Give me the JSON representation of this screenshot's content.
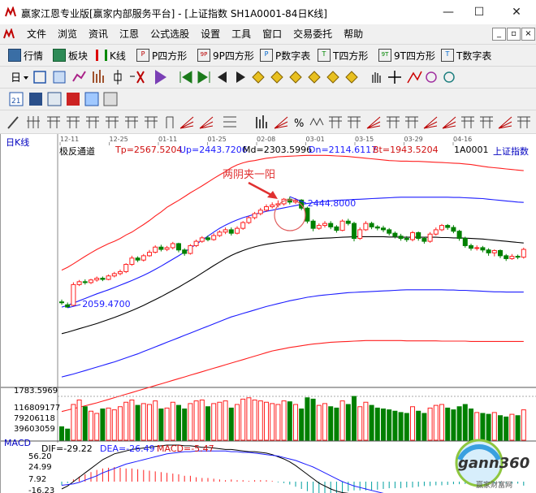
{
  "window": {
    "title": "赢家江恩专业版[赢家内部服务平台] - [上证指数  SH1A0001-84日K线]",
    "controls": [
      "—",
      "☐",
      "✕"
    ]
  },
  "menu": {
    "items": [
      "文件",
      "浏览",
      "资讯",
      "江恩",
      "公式选股",
      "设置",
      "工具",
      "窗口",
      "交易委托",
      "帮助"
    ],
    "mdi_controls": [
      "_",
      "▫",
      "×"
    ]
  },
  "toolbar1": {
    "buttons": [
      "行情",
      "板块",
      "K线",
      "P四方形",
      "9P四方形",
      "P数字表",
      "T四方形",
      "9T四方形",
      "T数字表"
    ],
    "icon_names": [
      "quotes-icon",
      "sector-icon",
      "kline-icon",
      "p-square-icon",
      "9p-square-icon",
      "p-number-table-icon",
      "t-square-icon",
      "9t-square-icon",
      "t-number-table-icon"
    ],
    "icon_glyphs": [
      "▦",
      "▤",
      "⫶",
      "P",
      "9P",
      "P",
      "T",
      "9T",
      "T"
    ]
  },
  "chart": {
    "period_label": "日K线",
    "indicator_name": "极反通道",
    "tp": "Tp=2567.5204",
    "up": "Up=2443.7206",
    "md": "Md=2303.5996",
    "dn": "Dn=2114.6117",
    "bt": "Bt=1943.5204",
    "symbol_code": "1A0001",
    "symbol_name": "上证指数",
    "date_ticks": [
      "12-11",
      "12-25",
      "01-11",
      "01-25",
      "02-08",
      "03-01",
      "03-15",
      "03-29",
      "04-16"
    ],
    "annotation": "两阴夹一阳",
    "high_label": "2444.8000",
    "low_label": "2059.4700",
    "volume_axis": [
      "1783.5969",
      "116809177",
      "79206118",
      "39603059"
    ],
    "macd_labels": {
      "name": "MACD",
      "dif": "DIF=-29.22",
      "dea": "DEA=-26.49",
      "macd": "MACD=-5.47"
    },
    "macd_axis": [
      "56.20",
      "24.99",
      "7.92",
      "-16.23"
    ],
    "colors": {
      "up": "#ff2020",
      "down": "#008000",
      "mid": "#000000",
      "inner": "#1c1cff"
    }
  },
  "watermark": {
    "text": "gann360",
    "sub": "赢家财富网"
  },
  "chart_data": {
    "type": "candlestick",
    "y_range": [
      1783.5969,
      2600
    ],
    "channel_series": [
      {
        "name": "Tp",
        "values": [
          2190,
          2200,
          2212,
          2225,
          2238,
          2250,
          2262,
          2272,
          2282,
          2290,
          2300,
          2312,
          2322,
          2335,
          2348,
          2362,
          2378,
          2392,
          2408,
          2420,
          2432,
          2445,
          2458,
          2470,
          2482,
          2495,
          2508,
          2520,
          2532,
          2545,
          2555,
          2562,
          2567,
          2570,
          2574,
          2578,
          2580,
          2583,
          2584,
          2585,
          2586,
          2587,
          2588,
          2588,
          2588,
          2588,
          2587,
          2586,
          2585,
          2584,
          2582,
          2580,
          2578,
          2576,
          2574,
          2572,
          2570,
          2569,
          2568,
          2568,
          2567,
          2567,
          2566,
          2565,
          2564,
          2563,
          2562,
          2561,
          2560,
          2558,
          2556,
          2553,
          2550,
          2547,
          2545,
          2543,
          2541,
          2539,
          2537,
          2535
        ]
      },
      {
        "name": "Up",
        "values": [
          2062,
          2068,
          2076,
          2084,
          2092,
          2100,
          2108,
          2115,
          2122,
          2130,
          2138,
          2146,
          2154,
          2163,
          2172,
          2182,
          2193,
          2204,
          2216,
          2228,
          2240,
          2253,
          2266,
          2280,
          2294,
          2308,
          2322,
          2335,
          2346,
          2356,
          2364,
          2372,
          2378,
          2384,
          2389,
          2394,
          2398,
          2402,
          2406,
          2410,
          2414,
          2418,
          2421,
          2424,
          2426,
          2428,
          2430,
          2432,
          2433,
          2434,
          2435,
          2436,
          2437,
          2438,
          2439,
          2440,
          2441,
          2442,
          2443,
          2443,
          2443,
          2443,
          2443,
          2443,
          2443,
          2443,
          2443,
          2442,
          2442,
          2441,
          2440,
          2439,
          2438,
          2436,
          2434,
          2432,
          2430,
          2428,
          2426,
          2425
        ]
      },
      {
        "name": "Md",
        "values": [
          1970,
          1975,
          1981,
          1987,
          1993,
          1999,
          2005,
          2012,
          2019,
          2026,
          2034,
          2042,
          2050,
          2059,
          2068,
          2078,
          2088,
          2098,
          2109,
          2120,
          2131,
          2143,
          2155,
          2167,
          2180,
          2193,
          2206,
          2218,
          2230,
          2241,
          2250,
          2258,
          2265,
          2271,
          2276,
          2280,
          2283,
          2286,
          2289,
          2291,
          2293,
          2295,
          2297,
          2299,
          2300,
          2301,
          2302,
          2303,
          2304,
          2305,
          2306,
          2306,
          2306,
          2306,
          2306,
          2306,
          2305,
          2305,
          2304,
          2304,
          2304,
          2304,
          2304,
          2304,
          2304,
          2303,
          2303,
          2302,
          2302,
          2301,
          2300,
          2299,
          2298,
          2296,
          2294,
          2292,
          2290,
          2288,
          2286,
          2284
        ]
      },
      {
        "name": "Dn",
        "values": [
          1820,
          1825,
          1830,
          1836,
          1842,
          1848,
          1854,
          1860,
          1866,
          1872,
          1879,
          1886,
          1893,
          1900,
          1908,
          1916,
          1924,
          1932,
          1940,
          1948,
          1956,
          1964,
          1972,
          1980,
          1988,
          1996,
          2004,
          2012,
          2020,
          2028,
          2034,
          2040,
          2046,
          2052,
          2058,
          2064,
          2069,
          2074,
          2079,
          2084,
          2088,
          2092,
          2096,
          2099,
          2102,
          2104,
          2106,
          2108,
          2110,
          2112,
          2113,
          2114,
          2115,
          2116,
          2117,
          2118,
          2119,
          2120,
          2121,
          2122,
          2122,
          2122,
          2122,
          2122,
          2122,
          2122,
          2121,
          2121,
          2120,
          2120,
          2119,
          2118,
          2117,
          2116,
          2115,
          2115,
          2114,
          2114,
          2114,
          2114
        ]
      },
      {
        "name": "Bt",
        "values": [
          1700,
          1705,
          1710,
          1715,
          1720,
          1725,
          1730,
          1736,
          1742,
          1748,
          1754,
          1760,
          1766,
          1772,
          1778,
          1784,
          1790,
          1796,
          1802,
          1808,
          1814,
          1820,
          1826,
          1832,
          1838,
          1844,
          1850,
          1856,
          1862,
          1868,
          1874,
          1880,
          1886,
          1892,
          1898,
          1904,
          1910,
          1914,
          1918,
          1922,
          1925,
          1928,
          1931,
          1934,
          1936,
          1938,
          1940,
          1941,
          1942,
          1943,
          1944,
          1945,
          1946,
          1946,
          1946,
          1946,
          1946,
          1946,
          1946,
          1945,
          1945,
          1945,
          1945,
          1945,
          1945,
          1944,
          1944,
          1944,
          1944,
          1944,
          1943,
          1943,
          1943,
          1943,
          1943,
          1943,
          1943,
          1943,
          1943,
          1943
        ]
      }
    ],
    "candles": [
      [
        2080,
        2078,
        2088,
        2070
      ],
      [
        2070,
        2062,
        2078,
        2059.47
      ],
      [
        2068,
        2140,
        2148,
        2065
      ],
      [
        2140,
        2150,
        2156,
        2135
      ],
      [
        2150,
        2147,
        2158,
        2140
      ],
      [
        2147,
        2156,
        2160,
        2142
      ],
      [
        2156,
        2162,
        2168,
        2150
      ],
      [
        2162,
        2158,
        2168,
        2152
      ],
      [
        2158,
        2170,
        2175,
        2155
      ],
      [
        2170,
        2178,
        2184,
        2165
      ],
      [
        2178,
        2185,
        2192,
        2172
      ],
      [
        2185,
        2210,
        2214,
        2180
      ],
      [
        2210,
        2232,
        2240,
        2205
      ],
      [
        2232,
        2225,
        2238,
        2218
      ],
      [
        2225,
        2240,
        2246,
        2220
      ],
      [
        2240,
        2252,
        2260,
        2236
      ],
      [
        2252,
        2270,
        2276,
        2248
      ],
      [
        2270,
        2262,
        2278,
        2255
      ],
      [
        2262,
        2268,
        2274,
        2256
      ],
      [
        2268,
        2282,
        2288,
        2262
      ],
      [
        2282,
        2260,
        2285,
        2252
      ],
      [
        2260,
        2248,
        2266,
        2240
      ],
      [
        2248,
        2275,
        2280,
        2244
      ],
      [
        2275,
        2290,
        2296,
        2270
      ],
      [
        2290,
        2302,
        2308,
        2285
      ],
      [
        2302,
        2296,
        2310,
        2290
      ],
      [
        2296,
        2310,
        2318,
        2292
      ],
      [
        2310,
        2322,
        2328,
        2305
      ],
      [
        2322,
        2330,
        2338,
        2315
      ],
      [
        2330,
        2318,
        2338,
        2310
      ],
      [
        2318,
        2335,
        2342,
        2314
      ],
      [
        2335,
        2355,
        2360,
        2330
      ],
      [
        2355,
        2372,
        2378,
        2350
      ],
      [
        2372,
        2386,
        2392,
        2366
      ],
      [
        2386,
        2398,
        2406,
        2380
      ],
      [
        2398,
        2410,
        2418,
        2392
      ],
      [
        2410,
        2416,
        2425,
        2404
      ],
      [
        2416,
        2420,
        2432,
        2408
      ],
      [
        2420,
        2436,
        2440,
        2414
      ],
      [
        2436,
        2426,
        2444.8,
        2418
      ],
      [
        2426,
        2433,
        2440,
        2420
      ],
      [
        2433,
        2405,
        2436,
        2398
      ],
      [
        2405,
        2360,
        2410,
        2352
      ],
      [
        2360,
        2335,
        2366,
        2325
      ],
      [
        2335,
        2345,
        2352,
        2330
      ],
      [
        2345,
        2352,
        2360,
        2338
      ],
      [
        2352,
        2340,
        2360,
        2332
      ],
      [
        2340,
        2328,
        2346,
        2320
      ],
      [
        2328,
        2360,
        2366,
        2325
      ],
      [
        2360,
        2352,
        2368,
        2345
      ],
      [
        2352,
        2300,
        2358,
        2290
      ],
      [
        2300,
        2330,
        2338,
        2295
      ],
      [
        2330,
        2352,
        2360,
        2326
      ],
      [
        2352,
        2340,
        2358,
        2332
      ],
      [
        2340,
        2336,
        2346,
        2328
      ],
      [
        2336,
        2330,
        2344,
        2322
      ],
      [
        2330,
        2318,
        2336,
        2310
      ],
      [
        2318,
        2308,
        2324,
        2300
      ],
      [
        2308,
        2300,
        2316,
        2292
      ],
      [
        2300,
        2296,
        2308,
        2288
      ],
      [
        2296,
        2320,
        2326,
        2290
      ],
      [
        2320,
        2300,
        2324,
        2292
      ],
      [
        2300,
        2290,
        2306,
        2282
      ],
      [
        2290,
        2315,
        2322,
        2285
      ],
      [
        2315,
        2330,
        2338,
        2310
      ],
      [
        2330,
        2345,
        2350,
        2325
      ],
      [
        2345,
        2338,
        2350,
        2330
      ],
      [
        2338,
        2325,
        2346,
        2318
      ],
      [
        2325,
        2300,
        2330,
        2292
      ],
      [
        2300,
        2275,
        2306,
        2268
      ],
      [
        2275,
        2266,
        2282,
        2258
      ],
      [
        2266,
        2268,
        2276,
        2258
      ],
      [
        2268,
        2260,
        2274,
        2252
      ],
      [
        2260,
        2250,
        2266,
        2240
      ],
      [
        2250,
        2258,
        2262,
        2238
      ],
      [
        2258,
        2240,
        2262,
        2232
      ],
      [
        2240,
        2230,
        2246,
        2222
      ],
      [
        2230,
        2238,
        2246,
        2226
      ],
      [
        2238,
        2235,
        2244,
        2228
      ],
      [
        2235,
        2262,
        2268,
        2230
      ]
    ],
    "volume": [
      30,
      25,
      80,
      90,
      75,
      65,
      60,
      70,
      72,
      68,
      75,
      85,
      90,
      78,
      82,
      80,
      88,
      70,
      72,
      85,
      78,
      70,
      82,
      88,
      90,
      75,
      82,
      85,
      88,
      72,
      80,
      92,
      95,
      90,
      88,
      85,
      82,
      80,
      88,
      86,
      80,
      70,
      95,
      92,
      78,
      82,
      75,
      72,
      88,
      80,
      98,
      75,
      85,
      78,
      72,
      70,
      68,
      65,
      62,
      60,
      75,
      65,
      60,
      72,
      78,
      80,
      72,
      68,
      75,
      80,
      70,
      62,
      60,
      58,
      62,
      55,
      52,
      58,
      55,
      68
    ],
    "macd": {
      "dif": [
        -10,
        -6,
        0,
        6,
        12,
        18,
        24,
        30,
        34,
        38,
        40,
        42,
        44,
        45,
        46,
        47,
        48,
        49,
        50,
        50,
        50,
        49,
        49,
        48,
        47,
        47,
        46,
        45,
        44,
        44,
        43,
        42,
        41,
        41,
        40,
        39,
        37,
        34,
        31,
        27,
        22,
        16,
        10,
        4,
        -2,
        -6,
        -10,
        -13,
        -15,
        -16,
        -18,
        -20,
        -22,
        -24,
        -25,
        -26,
        -27,
        -28,
        -29,
        -29,
        -30,
        -30,
        -30,
        -30,
        -30,
        -30,
        -30,
        -29.5,
        -29.5,
        -29.3,
        -29.2,
        -29.2,
        -29.2,
        -29.2,
        -29.2,
        -29.2,
        -29.2,
        -29.22,
        -29.22,
        -29.22
      ],
      "dea": [
        -5,
        -4,
        -3,
        -1,
        2,
        5,
        8,
        12,
        15,
        18,
        21,
        24,
        26,
        28,
        30,
        32,
        34,
        36,
        38,
        39,
        40,
        41,
        41,
        42,
        42,
        42,
        42,
        42,
        42,
        41,
        41,
        40,
        40,
        39,
        38,
        37,
        36,
        35,
        33,
        31,
        29,
        26,
        23,
        20,
        16,
        12,
        8,
        4,
        0,
        -3,
        -6,
        -8,
        -10,
        -12,
        -14,
        -16,
        -18,
        -19,
        -20,
        -21,
        -22,
        -23,
        -24,
        -24,
        -25,
        -25,
        -25.5,
        -26,
        -26,
        -26.2,
        -26.3,
        -26.4,
        -26.4,
        -26.4,
        -26.4,
        -26.4,
        -26.45,
        -26.49,
        -26.49,
        -26.49
      ],
      "hist": [
        -5,
        -2,
        3,
        7,
        10,
        13,
        16,
        18,
        19,
        20,
        19,
        18,
        18,
        17,
        16,
        15,
        14,
        13,
        12,
        11,
        10,
        8,
        8,
        6,
        5,
        5,
        4,
        3,
        2,
        3,
        2,
        2,
        1,
        2,
        2,
        2,
        1,
        -1,
        -2,
        -4,
        -7,
        -10,
        -13,
        -16,
        -18,
        -18,
        -18,
        -17,
        -15,
        -13,
        -12,
        -12,
        -12,
        -12,
        -11,
        -10,
        -9,
        -9,
        -9,
        -8,
        -8,
        -7,
        -6,
        -6,
        -5,
        -5,
        -4.5,
        -3.5,
        -3.5,
        -3.1,
        -2.9,
        -2.8,
        -2.8,
        -2.8,
        -2.8,
        -2.8,
        -2.77,
        -2.73,
        -2.73,
        -5.47
      ]
    }
  }
}
